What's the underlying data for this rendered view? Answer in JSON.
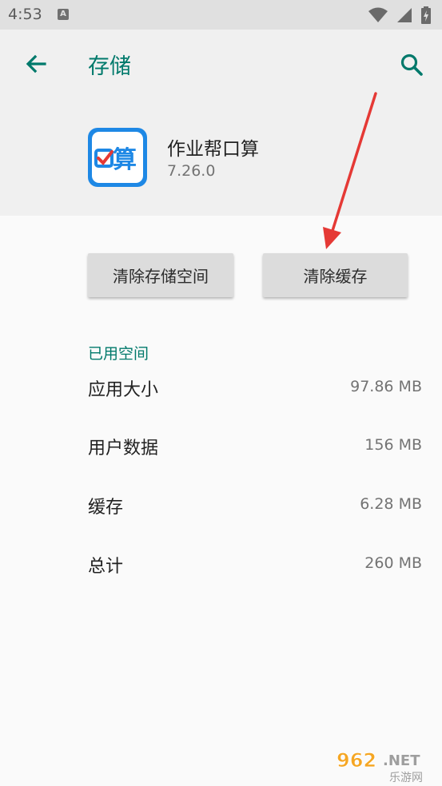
{
  "status_bar": {
    "time": "4:53",
    "notification_badge": "A",
    "icons": [
      "wifi-icon",
      "signal-icon",
      "battery-charging-icon"
    ]
  },
  "header": {
    "title": "存储",
    "back_icon": "arrow-left-icon",
    "search_icon": "search-icon"
  },
  "app": {
    "name": "作业帮口算",
    "version": "7.26.0",
    "icon_glyph": "口算"
  },
  "buttons": {
    "clear_storage": "清除存储空间",
    "clear_cache": "清除缓存"
  },
  "storage": {
    "section_title": "已用空间",
    "rows": [
      {
        "label": "应用大小",
        "value": "97.86 MB"
      },
      {
        "label": "用户数据",
        "value": "156 MB"
      },
      {
        "label": "缓存",
        "value": "6.28 MB"
      },
      {
        "label": "总计",
        "value": "260 MB"
      }
    ]
  },
  "watermark": {
    "main": "962.NET",
    "sub": "乐游网"
  },
  "colors": {
    "accent": "#00796b",
    "arrow": "#e53935",
    "app_icon_blue": "#1e88e5"
  }
}
